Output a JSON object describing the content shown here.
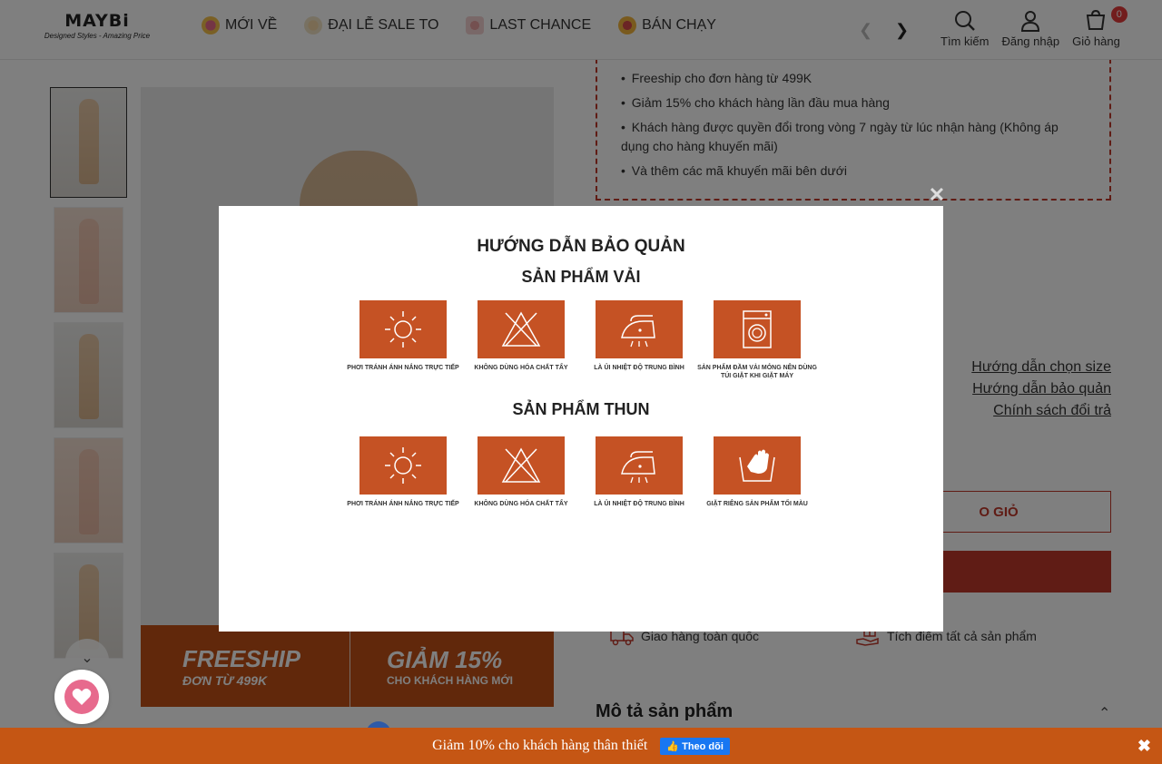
{
  "header": {
    "logo_brand": "MAYBi",
    "logo_slogan": "Designed Styles - Amazing Price",
    "nav": [
      {
        "label": "MỚI VỀ",
        "icon": "shopping-bags-icon"
      },
      {
        "label": "ĐẠI LỄ SALE TO",
        "icon": "dress-icon"
      },
      {
        "label": "LAST CHANCE",
        "icon": "bottle-icon"
      },
      {
        "label": "BÁN CHẠY",
        "icon": "hot-badge-icon"
      }
    ],
    "search_label": "Tìm kiếm",
    "login_label": "Đăng nhập",
    "cart_label": "Giỏ hàng",
    "cart_count": "0"
  },
  "banner": {
    "left_big": "FREESHIP",
    "left_small": "ĐƠN TỪ 499K",
    "right_big": "GIẢM 15%",
    "right_small": "CHO KHÁCH HÀNG MỚI"
  },
  "promo": {
    "items": [
      "Freeship cho đơn hàng từ 499K",
      "Giảm 15% cho khách hàng lần đầu mua hàng",
      "Khách hàng được quyền đổi trong vòng 7 ngày từ lúc nhận hàng (Không áp dụng cho hàng khuyến mãi)",
      "Và thêm các mã khuyến mãi bên dưới"
    ]
  },
  "links": {
    "size_guide": "Hướng dẫn chọn size",
    "care_guide": "Hướng dẫn bảo quản",
    "return_policy": "Chính sách đổi trả"
  },
  "buttons": {
    "add_to_cart_visible": "O GIỎ"
  },
  "features": {
    "shipping": "Giao hàng toàn quốc",
    "points": "Tích điểm tất cả sản phẩm"
  },
  "description_title": "Mô tả sản phẩm",
  "modal": {
    "title": "HƯỚNG DẪN BẢO QUẢN",
    "section1_title": "SẢN PHẨM VẢI",
    "section1_items": [
      {
        "icon": "sun-icon",
        "caption": "PHƠI TRÁNH ÁNH NẮNG TRỰC TIẾP"
      },
      {
        "icon": "no-bleach-icon",
        "caption": "KHÔNG DÙNG HÓA CHẤT TẨY"
      },
      {
        "icon": "iron-icon",
        "caption": "LÀ ỦI NHIỆT ĐỘ TRUNG BÌNH"
      },
      {
        "icon": "washing-machine-icon",
        "caption": "SẢN PHẨM ĐẦM VẢI MỎNG NÊN DÙNG TÚI GIẶT KHI GIẶT MÁY"
      }
    ],
    "section2_title": "SẢN PHẨM THUN",
    "section2_items": [
      {
        "icon": "sun-icon",
        "caption": "PHƠI TRÁNH ÁNH NẮNG TRỰC TIẾP"
      },
      {
        "icon": "no-bleach-icon",
        "caption": "KHÔNG DÙNG HÓA CHẤT TẨY"
      },
      {
        "icon": "iron-icon",
        "caption": "LÀ ỦI NHIỆT ĐỘ TRUNG BÌNH"
      },
      {
        "icon": "hand-wash-icon",
        "caption": "GIẶT RIÊNG SẢN PHẨM TỐI MÀU"
      }
    ]
  },
  "bottom_bar": {
    "text": "Giảm 10% cho khách hàng thân thiết",
    "follow_label": "Theo dõi"
  },
  "colors": {
    "accent": "#c0392b",
    "care_box": "#c55224",
    "bottom_bar": "#c55614",
    "facebook": "#1877f2"
  }
}
